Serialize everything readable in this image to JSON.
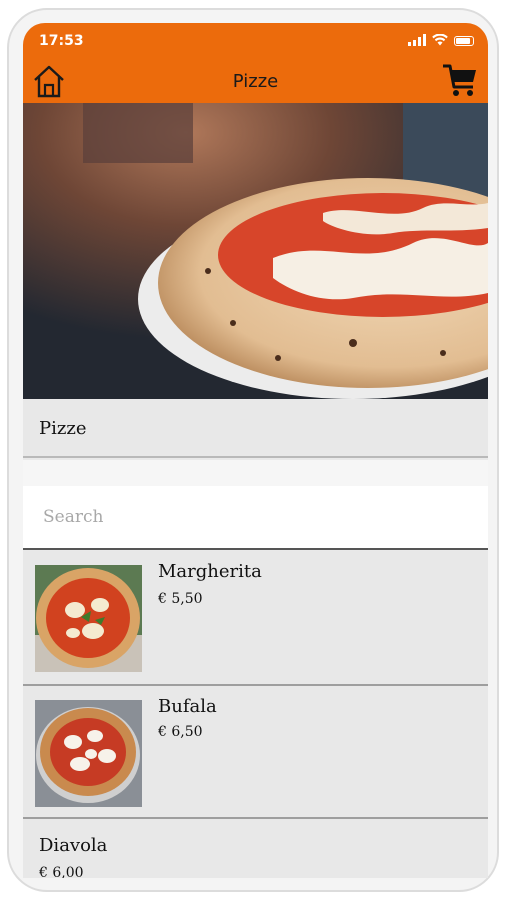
{
  "status": {
    "time": "17:53"
  },
  "header": {
    "title": "Pizze"
  },
  "section": {
    "title": "Pizze"
  },
  "search": {
    "placeholder": "Search",
    "value": ""
  },
  "products": [
    {
      "name": "Margherita",
      "price": "€ 5,50"
    },
    {
      "name": "Bufala",
      "price": "€ 6,50"
    },
    {
      "name": "Diavola",
      "price": "€ 6,00"
    }
  ],
  "colors": {
    "accent": "#ec6b0c",
    "background": "#e8e8e8"
  }
}
